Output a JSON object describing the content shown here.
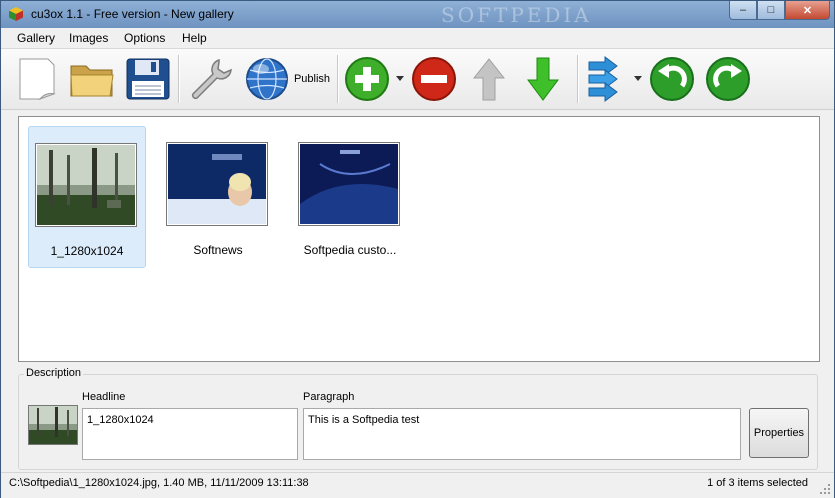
{
  "window": {
    "title": "cu3ox 1.1 - Free version - New gallery",
    "watermark": "SOFTPEDIA"
  },
  "window_controls": {
    "minimize": "–",
    "maximize": "□",
    "close": "✕"
  },
  "menu": [
    "Gallery",
    "Images",
    "Options",
    "Help"
  ],
  "toolbar": {
    "publish_label": "Publish",
    "icons": [
      "new-page-icon",
      "open-folder-icon",
      "save-disk-icon",
      "wrench-icon",
      "globe-icon",
      "add-icon",
      "remove-icon",
      "up-arrow-icon",
      "down-arrow-icon",
      "transition-arrows-icon",
      "undo-icon",
      "redo-icon"
    ],
    "colors": {
      "add": "#3fae2a",
      "remove": "#d02818",
      "down": "#3fc02a",
      "up": "#b8b8b8",
      "undo_redo": "#2e9e2a",
      "transition": "#2d8fd6"
    }
  },
  "gallery": {
    "items": [
      {
        "caption": "1_1280x1024"
      },
      {
        "caption": "Softnews"
      },
      {
        "caption": "Softpedia custo..."
      }
    ]
  },
  "description": {
    "legend": "Description",
    "headline_label": "Headline",
    "headline_value": "1_1280x1024",
    "paragraph_label": "Paragraph",
    "paragraph_value": "This is a Softpedia test",
    "properties_button": "Properties"
  },
  "status": {
    "file_info": "C:\\Softpedia\\1_1280x1024.jpg, 1.40 MB, 11/11/2009 13:11:38",
    "selection": "1 of 3 items selected"
  }
}
